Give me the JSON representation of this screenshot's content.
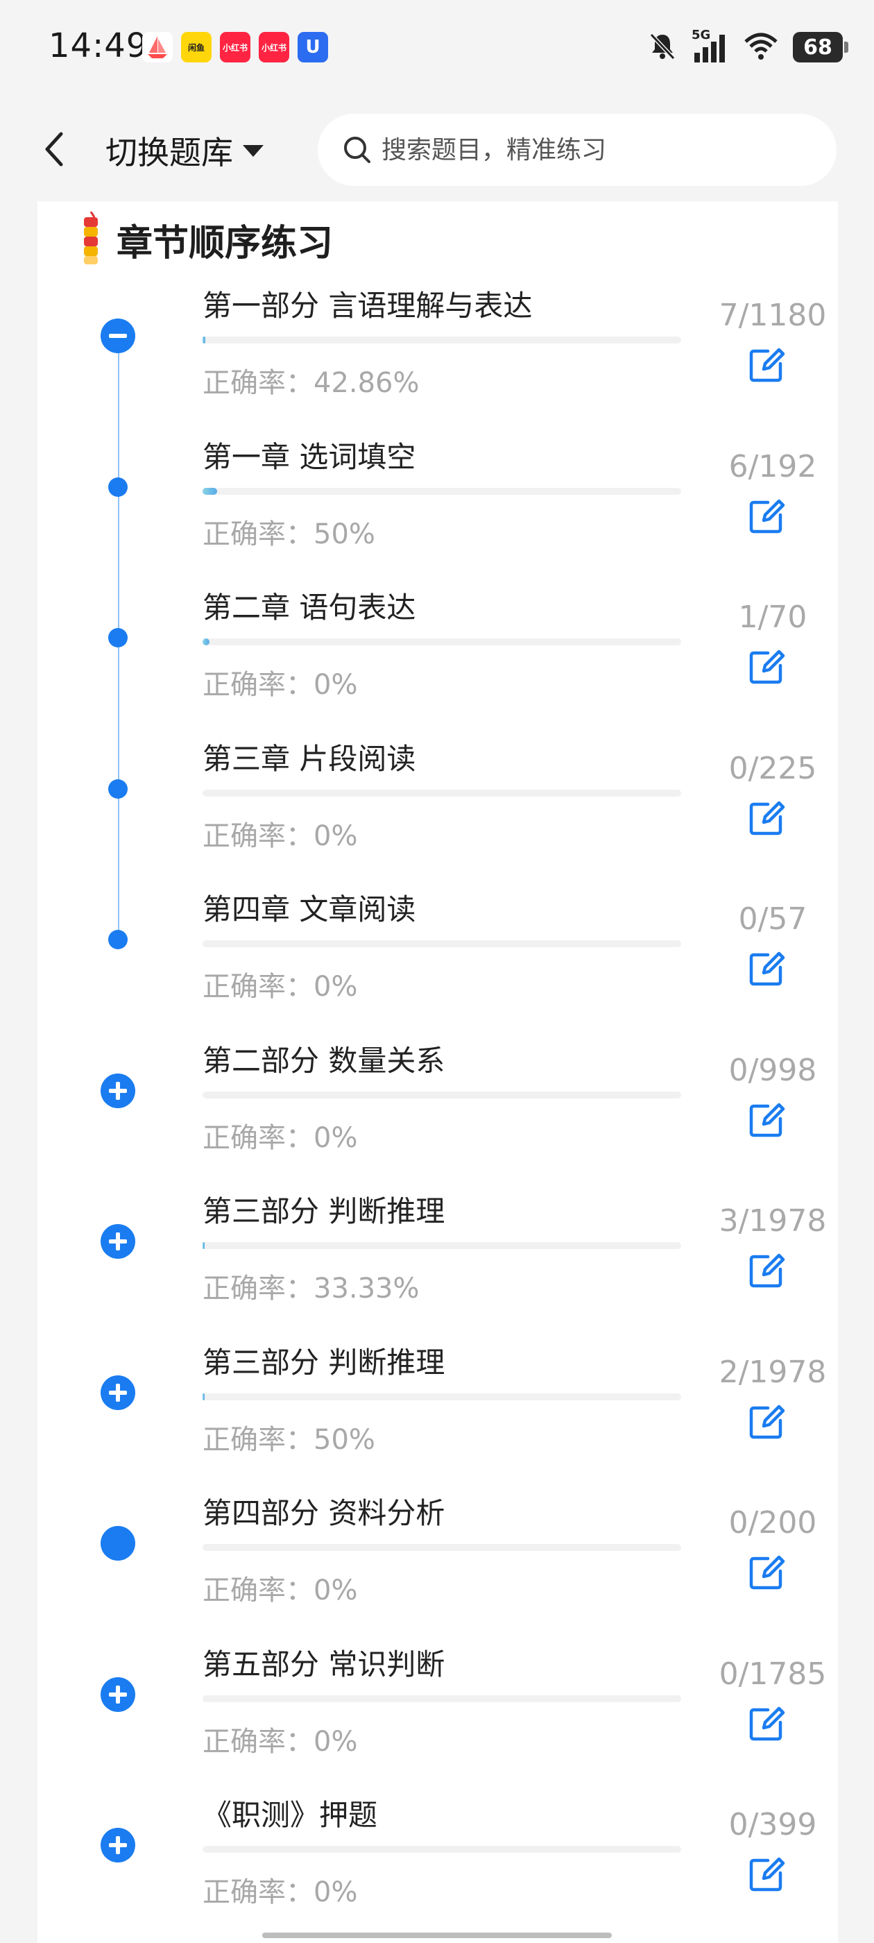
{
  "status_bar": {
    "time": "14:49",
    "notifications": [
      {
        "icon": "app-red-boat-icon",
        "color": "#ff4b4b",
        "text": ""
      },
      {
        "icon": "app-yellow-icon",
        "color": "#ffd60a",
        "text": "闲鱼"
      },
      {
        "icon": "xiaohongshu-icon",
        "color": "#ff2442",
        "text": "小红书"
      },
      {
        "icon": "xiaohongshu-icon-2",
        "color": "#ff2442",
        "text": "小红书"
      },
      {
        "icon": "app-blue-u-icon",
        "color": "#2b6cf0",
        "text": "U"
      }
    ],
    "signal": "5G",
    "battery": "68"
  },
  "header": {
    "switch_label": "切换题库",
    "search_placeholder": "搜索题目，精准练习"
  },
  "section": {
    "title": "章节顺序练习"
  },
  "items": [
    {
      "title": "第一部分 言语理解与表达",
      "accuracy_label": "正确率：42.86%",
      "count": "7/1180",
      "progress": 0.006,
      "marker": "collapse"
    },
    {
      "title": "第一章 选词填空",
      "accuracy_label": "正确率：50%",
      "count": "6/192",
      "progress": 0.031,
      "marker": "dot"
    },
    {
      "title": "第二章 语句表达",
      "accuracy_label": "正确率：0%",
      "count": "1/70",
      "progress": 0.014,
      "marker": "dot"
    },
    {
      "title": "第三章 片段阅读",
      "accuracy_label": "正确率：0%",
      "count": "0/225",
      "progress": 0,
      "marker": "dot"
    },
    {
      "title": "第四章 文章阅读",
      "accuracy_label": "正确率：0%",
      "count": "0/57",
      "progress": 0,
      "marker": "dot"
    },
    {
      "title": "第二部分 数量关系",
      "accuracy_label": "正确率：0%",
      "count": "0/998",
      "progress": 0,
      "marker": "expand"
    },
    {
      "title": "第三部分 判断推理",
      "accuracy_label": "正确率：33.33%",
      "count": "3/1978",
      "progress": 0.0015,
      "marker": "expand"
    },
    {
      "title": "第三部分 判断推理",
      "accuracy_label": "正确率：50%",
      "count": "2/1978",
      "progress": 0.001,
      "marker": "expand"
    },
    {
      "title": "第四部分 资料分析",
      "accuracy_label": "正确率：0%",
      "count": "0/200",
      "progress": 0,
      "marker": "solid"
    },
    {
      "title": "第五部分 常识判断",
      "accuracy_label": "正确率：0%",
      "count": "0/1785",
      "progress": 0,
      "marker": "expand"
    },
    {
      "title": "《职测》押题",
      "accuracy_label": "正确率：0%",
      "count": "0/399",
      "progress": 0,
      "marker": "expand"
    }
  ],
  "colors": {
    "accent": "#1a7cf0",
    "count_text": "#a9a9a9",
    "accuracy_text": "#a8a8a8"
  }
}
